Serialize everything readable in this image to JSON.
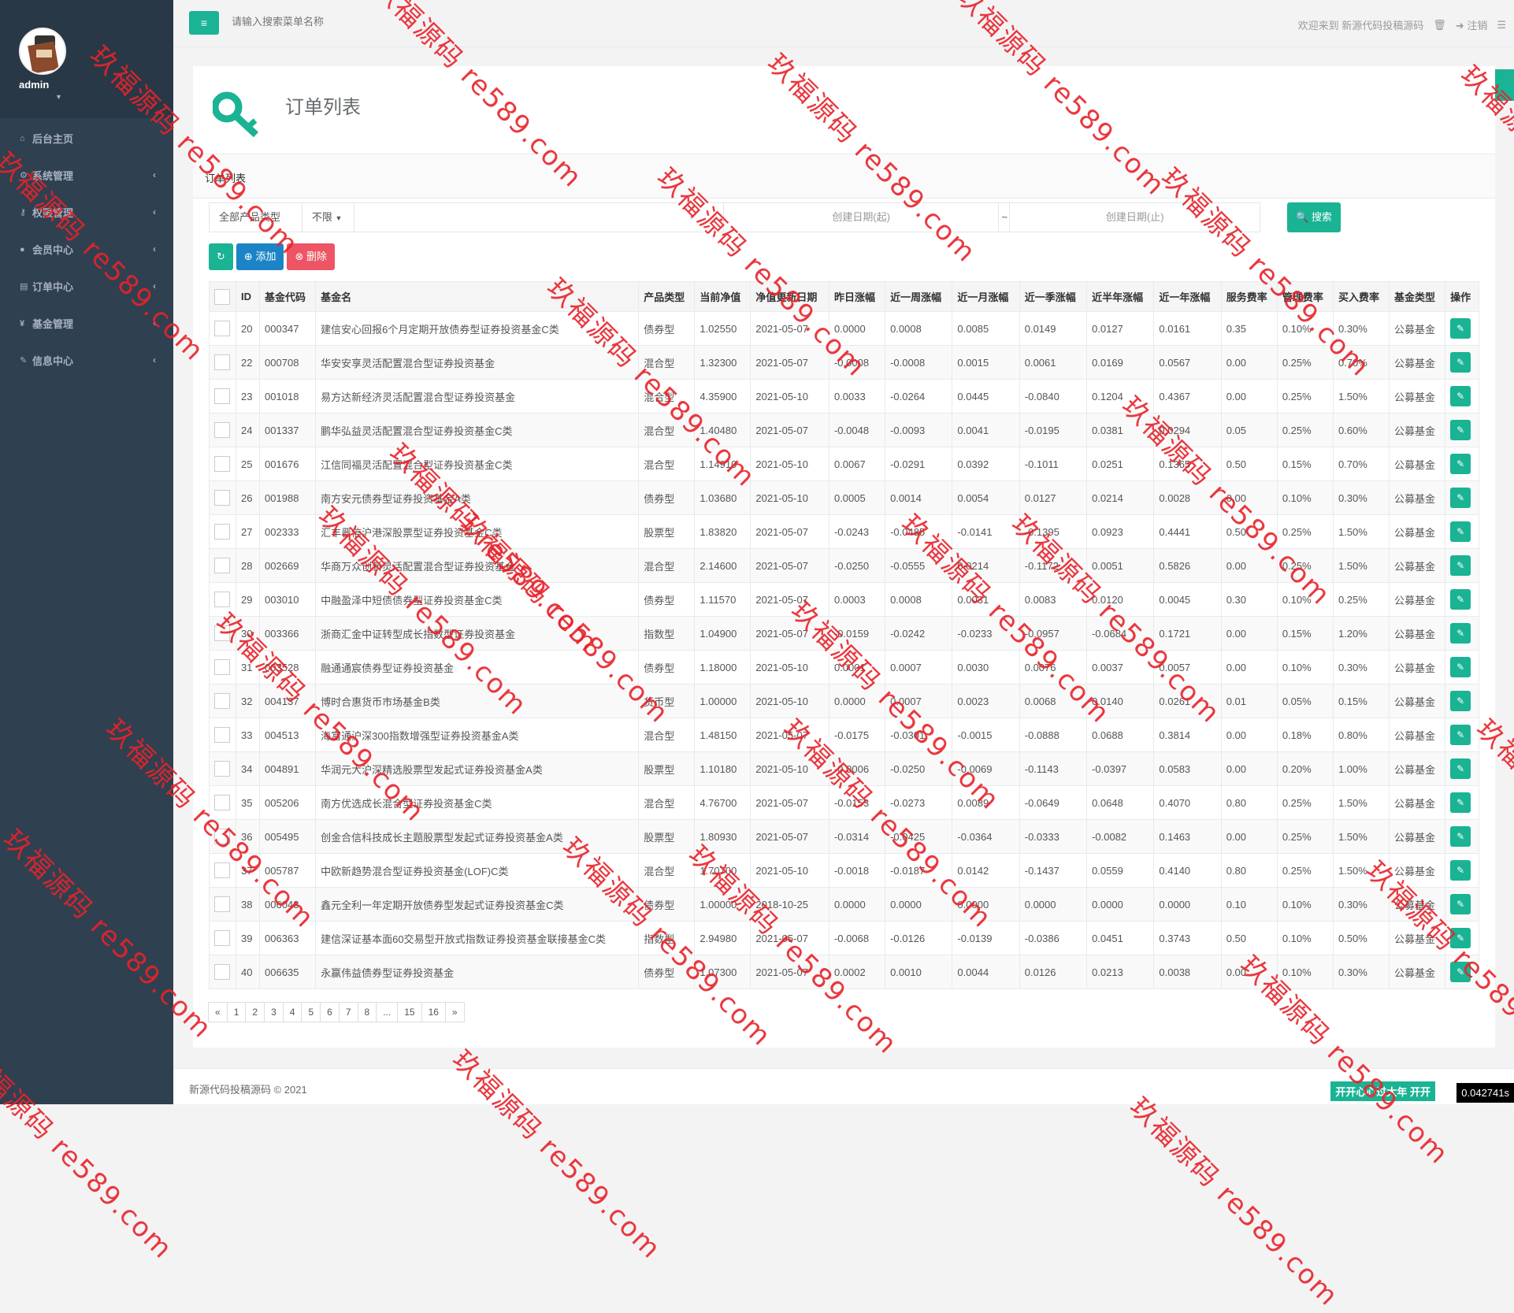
{
  "sidebar": {
    "user": "admin",
    "items": [
      {
        "label": "后台主页",
        "icon": "home-icon"
      },
      {
        "label": "系统管理",
        "icon": "gears-icon"
      },
      {
        "label": "权限管理",
        "icon": "key-icon"
      },
      {
        "label": "会员中心",
        "icon": "user-icon"
      },
      {
        "label": "订单中心",
        "icon": "list-icon"
      },
      {
        "label": "基金管理",
        "icon": "yen-icon"
      },
      {
        "label": "信息中心",
        "icon": "wrench-icon"
      }
    ]
  },
  "topbar": {
    "search_placeholder": "请输入搜索菜单名称",
    "welcome": "欢迎来到 新源代码投稿源码",
    "logout": "注销"
  },
  "page": {
    "title": "订单列表",
    "list_title": "订单列表"
  },
  "filters": {
    "product_type_label": "全部产品类型",
    "product_type_value": "不限",
    "date_start_placeholder": "创建日期(起)",
    "date_sep": "~",
    "date_end_placeholder": "创建日期(止)",
    "search_button": "搜索"
  },
  "toolbar": {
    "add": "添加",
    "delete": "删除"
  },
  "table": {
    "headers": [
      "ID",
      "基金代码",
      "基金名",
      "产品类型",
      "当前净值",
      "净值更新日期",
      "昨日涨幅",
      "近一周涨幅",
      "近一月涨幅",
      "近一季涨幅",
      "近半年涨幅",
      "近一年涨幅",
      "服务费率",
      "管理费率",
      "买入费率",
      "基金类型",
      "操作"
    ],
    "rows": [
      [
        "20",
        "000347",
        "建信安心回报6个月定期开放债券型证券投资基金C类",
        "债券型",
        "1.02550",
        "2021-05-07",
        "0.0000",
        "0.0008",
        "0.0085",
        "0.0149",
        "0.0127",
        "0.0161",
        "0.35",
        "0.10%",
        "0.30%",
        "公募基金"
      ],
      [
        "22",
        "000708",
        "华安安享灵活配置混合型证券投资基金",
        "混合型",
        "1.32300",
        "2021-05-07",
        "-0.0008",
        "-0.0008",
        "0.0015",
        "0.0061",
        "0.0169",
        "0.0567",
        "0.00",
        "0.25%",
        "0.70%",
        "公募基金"
      ],
      [
        "23",
        "001018",
        "易方达新经济灵活配置混合型证券投资基金",
        "混合型",
        "4.35900",
        "2021-05-10",
        "0.0033",
        "-0.0264",
        "0.0445",
        "-0.0840",
        "0.1204",
        "0.4367",
        "0.00",
        "0.25%",
        "1.50%",
        "公募基金"
      ],
      [
        "24",
        "001337",
        "鹏华弘益灵活配置混合型证券投资基金C类",
        "混合型",
        "1.40480",
        "2021-05-07",
        "-0.0048",
        "-0.0093",
        "0.0041",
        "-0.0195",
        "0.0381",
        "0.0294",
        "0.05",
        "0.25%",
        "0.60%",
        "公募基金"
      ],
      [
        "25",
        "001676",
        "江信同福灵活配置混合型证券投资基金C类",
        "混合型",
        "1.14910",
        "2021-05-10",
        "0.0067",
        "-0.0291",
        "0.0392",
        "-0.1011",
        "0.0251",
        "0.1365",
        "0.50",
        "0.15%",
        "0.70%",
        "公募基金"
      ],
      [
        "26",
        "001988",
        "南方安元债券型证券投资基金A类",
        "债券型",
        "1.03680",
        "2021-05-10",
        "0.0005",
        "0.0014",
        "0.0054",
        "0.0127",
        "0.0214",
        "0.0028",
        "0.00",
        "0.10%",
        "0.30%",
        "公募基金"
      ],
      [
        "27",
        "002333",
        "汇丰晋信沪港深股票型证券投资基金C类",
        "股票型",
        "1.83820",
        "2021-05-07",
        "-0.0243",
        "-0.0485",
        "-0.0141",
        "-0.1395",
        "0.0923",
        "0.4441",
        "0.50",
        "0.25%",
        "1.50%",
        "公募基金"
      ],
      [
        "28",
        "002669",
        "华商万众创新灵活配置混合型证券投资基金",
        "混合型",
        "2.14600",
        "2021-05-07",
        "-0.0250",
        "-0.0555",
        "0.0214",
        "-0.1172",
        "0.0051",
        "0.5826",
        "0.00",
        "0.25%",
        "1.50%",
        "公募基金"
      ],
      [
        "29",
        "003010",
        "中融盈泽中短债债券型证券投资基金C类",
        "债券型",
        "1.11570",
        "2021-05-07",
        "0.0003",
        "0.0008",
        "0.0031",
        "0.0083",
        "0.0120",
        "0.0045",
        "0.30",
        "0.10%",
        "0.25%",
        "公募基金"
      ],
      [
        "30",
        "003366",
        "浙商汇金中证转型成长指数型证券投资基金",
        "指数型",
        "1.04900",
        "2021-05-07",
        "-0.0159",
        "-0.0242",
        "-0.0233",
        "-0.0957",
        "-0.0684",
        "0.1721",
        "0.00",
        "0.15%",
        "1.20%",
        "公募基金"
      ],
      [
        "31",
        "003528",
        "融通通宸债券型证券投资基金",
        "债券型",
        "1.18000",
        "2021-05-10",
        "0.0001",
        "0.0007",
        "0.0030",
        "0.0076",
        "0.0037",
        "0.0057",
        "0.00",
        "0.10%",
        "0.30%",
        "公募基金"
      ],
      [
        "32",
        "004137",
        "博时合惠货币市场基金B类",
        "货币型",
        "1.00000",
        "2021-05-10",
        "0.0000",
        "0.0007",
        "0.0023",
        "0.0068",
        "0.0140",
        "0.0261",
        "0.01",
        "0.05%",
        "0.15%",
        "公募基金"
      ],
      [
        "33",
        "004513",
        "海富通沪深300指数增强型证券投资基金A类",
        "混合型",
        "1.48150",
        "2021-05-07",
        "-0.0175",
        "-0.0301",
        "-0.0015",
        "-0.0888",
        "0.0688",
        "0.3814",
        "0.00",
        "0.18%",
        "0.80%",
        "公募基金"
      ],
      [
        "34",
        "004891",
        "华润元大沪深精选股票型发起式证券投资基金A类",
        "股票型",
        "1.10180",
        "2021-05-10",
        "-0.0006",
        "-0.0250",
        "-0.0069",
        "-0.1143",
        "-0.0397",
        "0.0583",
        "0.00",
        "0.20%",
        "1.00%",
        "公募基金"
      ],
      [
        "35",
        "005206",
        "南方优选成长混合型证券投资基金C类",
        "混合型",
        "4.76700",
        "2021-05-07",
        "-0.0153",
        "-0.0273",
        "0.0089",
        "-0.0649",
        "0.0648",
        "0.4070",
        "0.80",
        "0.25%",
        "1.50%",
        "公募基金"
      ],
      [
        "36",
        "005495",
        "创金合信科技成长主题股票型发起式证券投资基金A类",
        "股票型",
        "1.80930",
        "2021-05-07",
        "-0.0314",
        "-0.0425",
        "-0.0364",
        "-0.0333",
        "-0.0082",
        "0.1463",
        "0.00",
        "0.25%",
        "1.50%",
        "公募基金"
      ],
      [
        "37",
        "005787",
        "中欧新趋势混合型证券投资基金(LOF)C类",
        "混合型",
        "1.70700",
        "2021-05-10",
        "-0.0018",
        "-0.0187",
        "0.0142",
        "-0.1437",
        "0.0559",
        "0.4140",
        "0.80",
        "0.25%",
        "1.50%",
        "公募基金"
      ],
      [
        "38",
        "006043",
        "鑫元全利一年定期开放债券型发起式证券投资基金C类",
        "债券型",
        "1.00000",
        "2018-10-25",
        "0.0000",
        "0.0000",
        "0.0000",
        "0.0000",
        "0.0000",
        "0.0000",
        "0.10",
        "0.10%",
        "0.30%",
        "公募基金"
      ],
      [
        "39",
        "006363",
        "建信深证基本面60交易型开放式指数证券投资基金联接基金C类",
        "指数型",
        "2.94980",
        "2021-05-07",
        "-0.0068",
        "-0.0126",
        "-0.0139",
        "-0.0386",
        "0.0451",
        "0.3743",
        "0.50",
        "0.10%",
        "0.50%",
        "公募基金"
      ],
      [
        "40",
        "006635",
        "永赢伟益债券型证券投资基金",
        "债券型",
        "1.07300",
        "2021-05-07",
        "0.0002",
        "0.0010",
        "0.0044",
        "0.0126",
        "0.0213",
        "0.0038",
        "0.00",
        "0.10%",
        "0.30%",
        "公募基金"
      ]
    ]
  },
  "pagination": [
    "«",
    "1",
    "2",
    "3",
    "4",
    "5",
    "6",
    "7",
    "8",
    "...",
    "15",
    "16",
    "»"
  ],
  "footer": {
    "copyright": "新源代码投稿源码 © 2021",
    "badge": "开开心心过大年 开开",
    "timer": "0.042741s"
  },
  "watermark": "玖福源码 re589.com",
  "colors": {
    "accent": "#1ab394",
    "sidebar": "#2f4050",
    "primary": "#1c84c6",
    "danger": "#ed5565",
    "watermark": "#e8232a"
  }
}
